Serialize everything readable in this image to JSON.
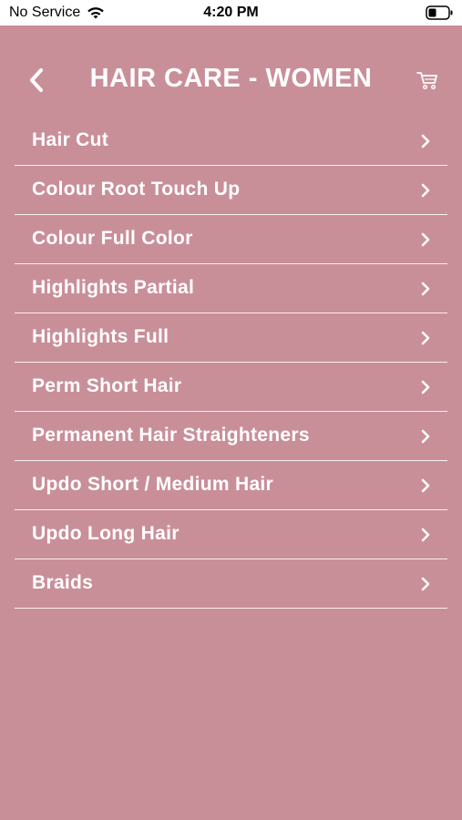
{
  "status_bar": {
    "carrier": "No Service",
    "time": "4:20 PM"
  },
  "header": {
    "title": "HAIR CARE - WOMEN",
    "back_icon": "chevron-left-icon",
    "cart_icon": "cart-icon"
  },
  "services": [
    {
      "label": "Hair Cut"
    },
    {
      "label": "Colour Root Touch Up"
    },
    {
      "label": "Colour Full Color"
    },
    {
      "label": "Highlights Partial"
    },
    {
      "label": "Highlights Full"
    },
    {
      "label": "Perm Short Hair"
    },
    {
      "label": "Permanent Hair Straighteners"
    },
    {
      "label": "Updo Short / Medium Hair"
    },
    {
      "label": "Updo Long Hair"
    },
    {
      "label": "Braids"
    }
  ],
  "colors": {
    "background": "#c98f99",
    "text": "#ffffff",
    "divider": "#ffffff"
  }
}
